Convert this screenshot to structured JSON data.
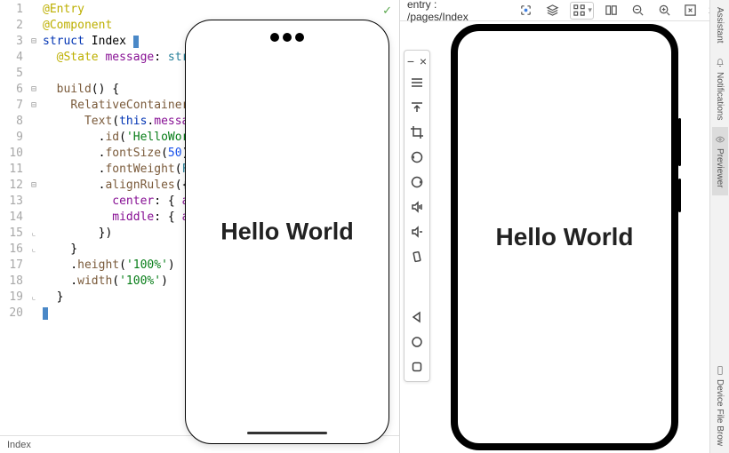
{
  "editor": {
    "status_label": "Index",
    "check_icon": "✓",
    "lines": [
      {
        "n": 1,
        "tokens": [
          {
            "t": "@Entry",
            "c": "c-ann"
          }
        ]
      },
      {
        "n": 2,
        "tokens": [
          {
            "t": "@Component",
            "c": "c-ann"
          }
        ]
      },
      {
        "n": 3,
        "tokens": [
          {
            "t": "struct",
            "c": "c-kw"
          },
          {
            "t": " "
          },
          {
            "t": "Index",
            "c": "c-ident"
          },
          {
            "t": " "
          },
          {
            "cursor": true
          }
        ],
        "highlight": false
      },
      {
        "n": 4,
        "tokens": [
          {
            "t": "  "
          },
          {
            "t": "@State",
            "c": "c-ann"
          },
          {
            "t": " "
          },
          {
            "t": "message",
            "c": "c-prop"
          },
          {
            "t": ": "
          },
          {
            "t": "string",
            "c": "c-type"
          },
          {
            "t": " ="
          }
        ]
      },
      {
        "n": 5,
        "tokens": []
      },
      {
        "n": 6,
        "tokens": [
          {
            "t": "  "
          },
          {
            "t": "build",
            "c": "c-func"
          },
          {
            "t": "() {",
            "c": "c-brace"
          }
        ]
      },
      {
        "n": 7,
        "tokens": [
          {
            "t": "    "
          },
          {
            "t": "RelativeContainer",
            "c": "c-func"
          },
          {
            "t": "() {",
            "c": "c-brace"
          }
        ]
      },
      {
        "n": 8,
        "tokens": [
          {
            "t": "      "
          },
          {
            "t": "Text",
            "c": "c-func"
          },
          {
            "t": "("
          },
          {
            "t": "this",
            "c": "c-this"
          },
          {
            "t": "."
          },
          {
            "t": "message",
            "c": "c-prop"
          },
          {
            "t": ")"
          }
        ]
      },
      {
        "n": 9,
        "tokens": [
          {
            "t": "        ."
          },
          {
            "t": "id",
            "c": "c-func"
          },
          {
            "t": "("
          },
          {
            "t": "'HelloWorld'",
            "c": "c-str"
          },
          {
            "t": ")"
          }
        ]
      },
      {
        "n": 10,
        "tokens": [
          {
            "t": "        ."
          },
          {
            "t": "fontSize",
            "c": "c-func"
          },
          {
            "t": "("
          },
          {
            "t": "50",
            "c": "c-num"
          },
          {
            "t": ")"
          }
        ]
      },
      {
        "n": 11,
        "tokens": [
          {
            "t": "        ."
          },
          {
            "t": "fontWeight",
            "c": "c-func"
          },
          {
            "t": "("
          },
          {
            "t": "FontWe",
            "c": "c-type"
          }
        ]
      },
      {
        "n": 12,
        "tokens": [
          {
            "t": "        ."
          },
          {
            "t": "alignRules",
            "c": "c-func"
          },
          {
            "t": "({",
            "c": "c-brace"
          }
        ]
      },
      {
        "n": 13,
        "tokens": [
          {
            "t": "          "
          },
          {
            "t": "center",
            "c": "c-prop"
          },
          {
            "t": ": { "
          },
          {
            "t": "anchor",
            "c": "c-prop"
          }
        ]
      },
      {
        "n": 14,
        "tokens": [
          {
            "t": "          "
          },
          {
            "t": "middle",
            "c": "c-prop"
          },
          {
            "t": ": { "
          },
          {
            "t": "anchor",
            "c": "c-prop"
          }
        ]
      },
      {
        "n": 15,
        "tokens": [
          {
            "t": "        })",
            "c": "c-brace"
          }
        ]
      },
      {
        "n": 16,
        "tokens": [
          {
            "t": "    }",
            "c": "c-brace"
          }
        ]
      },
      {
        "n": 17,
        "tokens": [
          {
            "t": "    ."
          },
          {
            "t": "height",
            "c": "c-func"
          },
          {
            "t": "("
          },
          {
            "t": "'100%'",
            "c": "c-str"
          },
          {
            "t": ")"
          }
        ]
      },
      {
        "n": 18,
        "tokens": [
          {
            "t": "    ."
          },
          {
            "t": "width",
            "c": "c-func"
          },
          {
            "t": "("
          },
          {
            "t": "'100%'",
            "c": "c-str"
          },
          {
            "t": ")"
          }
        ]
      },
      {
        "n": 19,
        "tokens": [
          {
            "t": "  }",
            "c": "c-brace"
          }
        ]
      },
      {
        "n": 20,
        "tokens": [
          {
            "cursor": true
          }
        ],
        "highlight": true
      }
    ]
  },
  "emulator_left": {
    "display_text": "Hello World"
  },
  "emu_toolbar": {
    "minimize": "−",
    "close": "×"
  },
  "preview": {
    "path_label": "entry : /pages/Index",
    "ratio": "1:1",
    "display_text": "Hello World"
  },
  "side_tabs": {
    "assistant": "Assistant",
    "notifications": "Notifications",
    "previewer": "Previewer",
    "device_file": "Device File Brow"
  }
}
